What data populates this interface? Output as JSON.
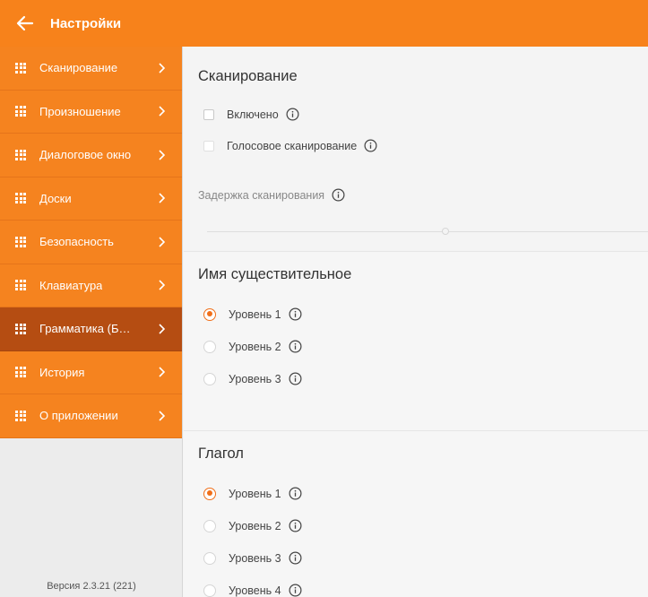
{
  "appbar": {
    "title": "Настройки",
    "back_icon": "arrow-left-icon"
  },
  "sidebar": {
    "items": [
      {
        "label": "Сканирование"
      },
      {
        "label": "Произношение"
      },
      {
        "label": "Диалоговое окно"
      },
      {
        "label": "Доски"
      },
      {
        "label": "Безопасность"
      },
      {
        "label": "Клавиатура"
      },
      {
        "label": "Грамматика (БЕТА)"
      },
      {
        "label": "История"
      },
      {
        "label": "О приложении"
      }
    ],
    "active_index": 6,
    "version": "Версия 2.3.21 (221)"
  },
  "scan": {
    "title": "Сканирование",
    "enabled_label": "Включено",
    "voice_label": "Голосовое сканирование",
    "delay_label": "Задержка сканирования",
    "delay_value": 0.54
  },
  "noun": {
    "title": "Имя существительное",
    "options": [
      "Уровень 1",
      "Уровень 2",
      "Уровень 3"
    ],
    "selected": 0
  },
  "verb": {
    "title": "Глагол",
    "options": [
      "Уровень 1",
      "Уровень 2",
      "Уровень 3",
      "Уровень 4"
    ],
    "selected": 0
  },
  "colors": {
    "accent": "#f7821b",
    "active_item": "#b54d12",
    "radio": "#f06f1a"
  }
}
